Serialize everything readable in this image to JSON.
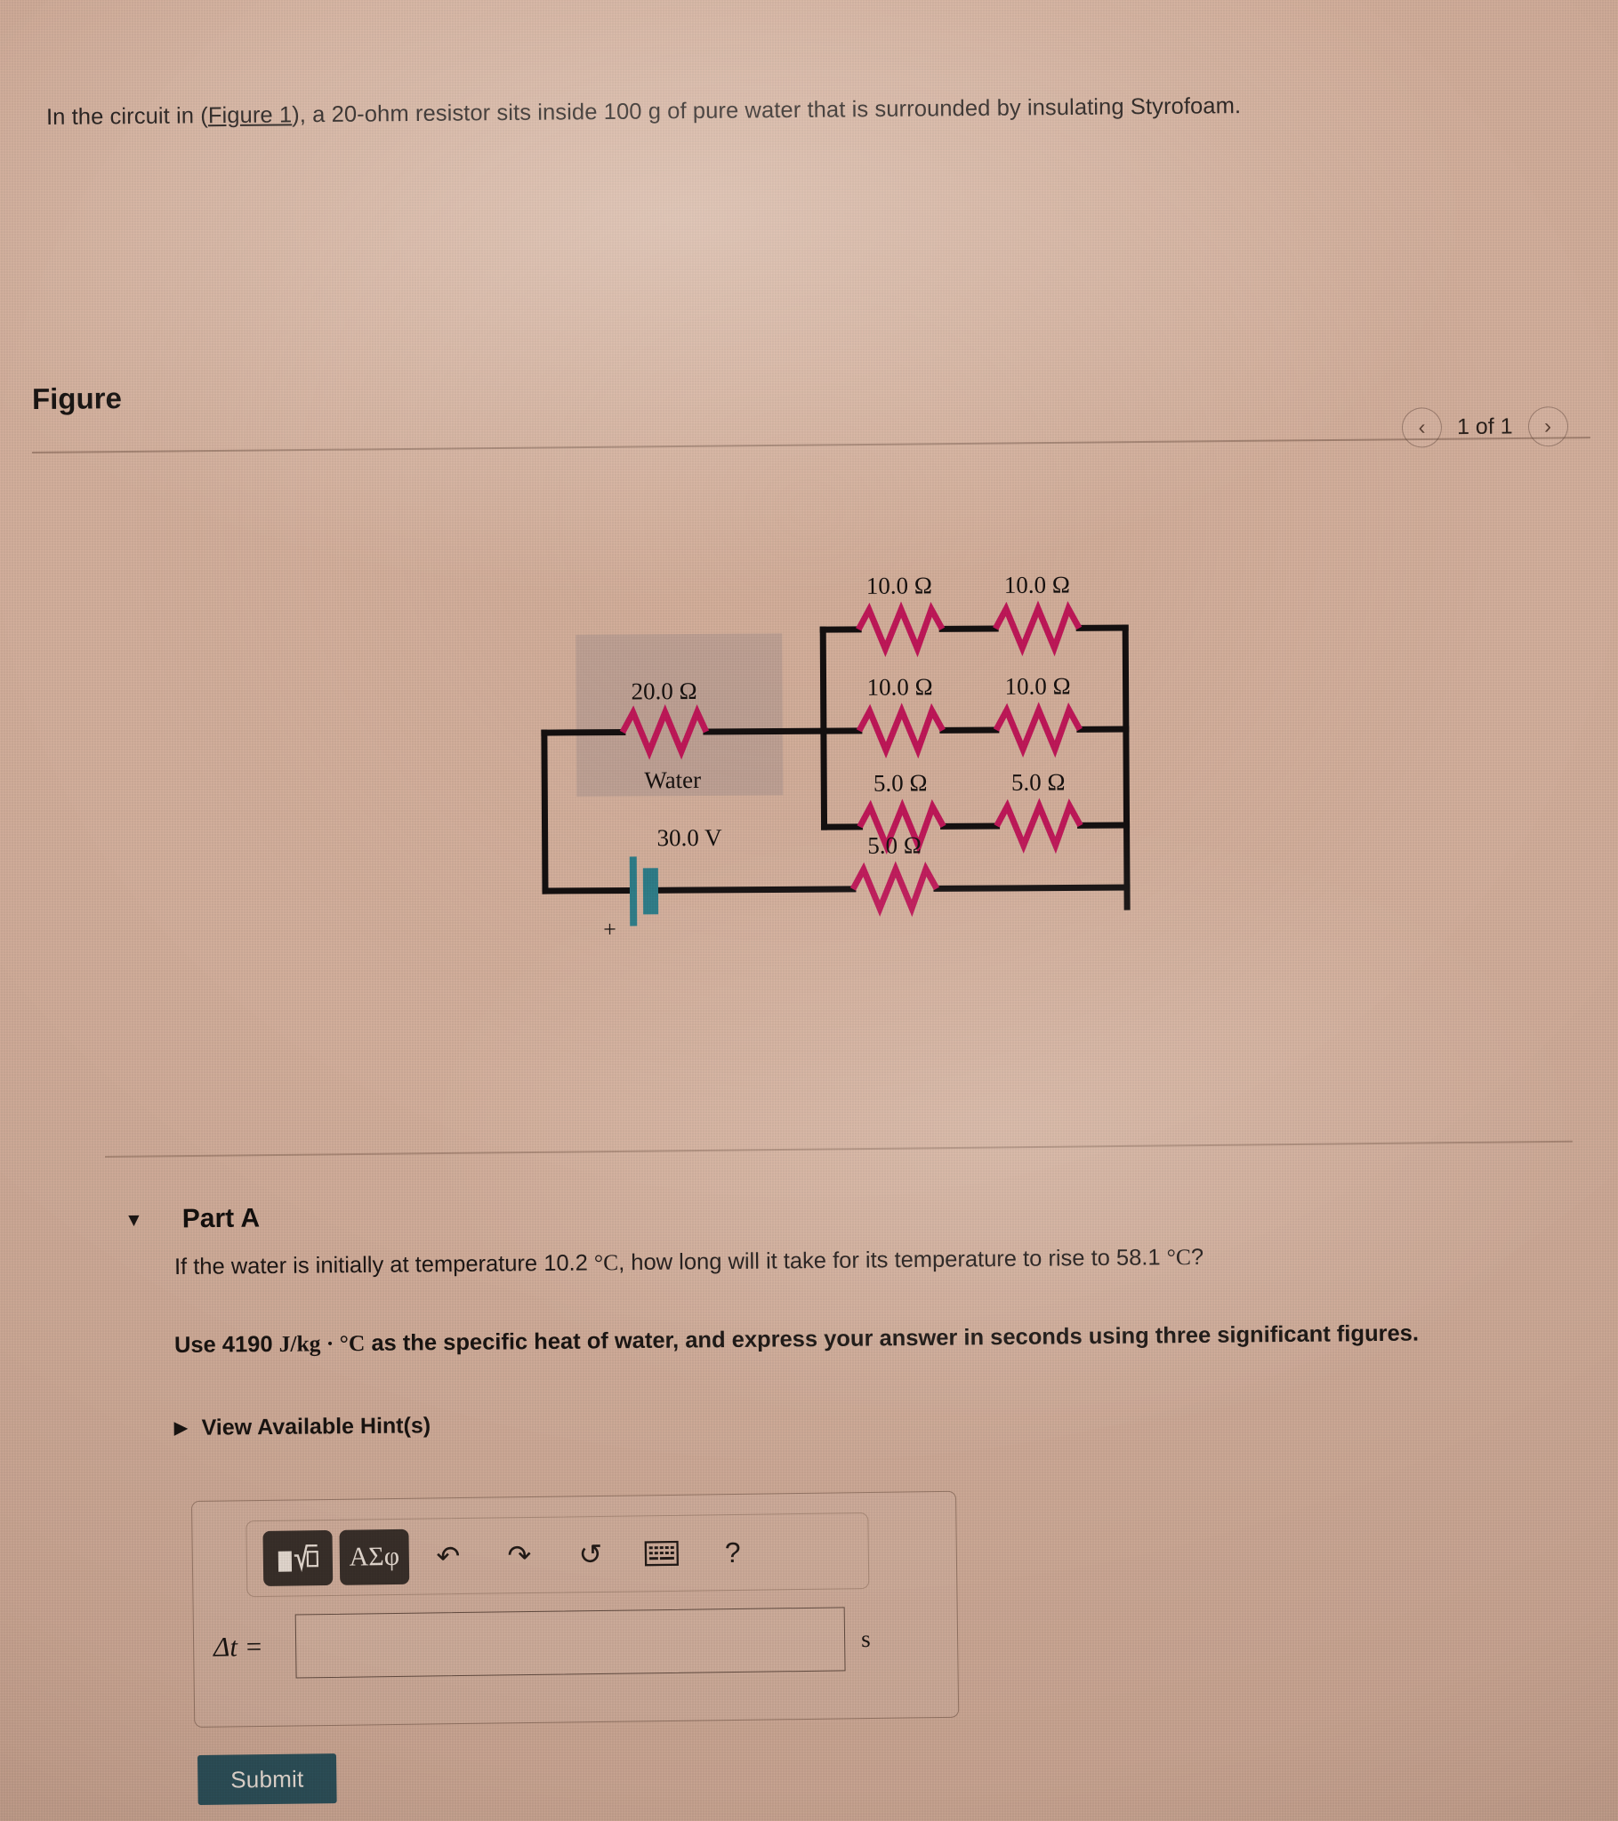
{
  "problem": {
    "text_before_link": "In the circuit in (",
    "figure_link": "Figure 1",
    "text_after_link": "), a 20-ohm resistor sits inside 100 g of pure water that is surrounded by insulating Styrofoam."
  },
  "figure": {
    "title": "Figure",
    "pager_label": "1 of 1",
    "prev_icon": "chevron-left-icon",
    "next_icon": "chevron-right-icon"
  },
  "circuit": {
    "water_label": "Water",
    "heater_resistor": "20.0 Ω",
    "battery_voltage": "30.0 V",
    "battery_polarity": "+",
    "row_top": {
      "left": "10.0 Ω",
      "right": "10.0 Ω"
    },
    "row_middle": {
      "left": "10.0 Ω",
      "right": "10.0 Ω"
    },
    "row_lower": {
      "left": "5.0 Ω",
      "right": "5.0 Ω"
    },
    "row_bottom": {
      "resistor": "5.0 Ω"
    },
    "colors": {
      "wire": "#141010",
      "resistor": "#c2185b",
      "battery": "#2e7f8c",
      "water_box": "rgba(120,120,128,0.22)"
    }
  },
  "part_a": {
    "caret": "▼",
    "label": "Part A",
    "question_p1": "If the water is initially at temperature 10.2 ",
    "question_deg1": "°C",
    "question_p2": ", how long will it take for its temperature to rise to 58.1 ",
    "question_deg2": "°C",
    "question_p3": "?",
    "instruction_p1": "Use 4190 ",
    "instruction_units": "J/kg · °C",
    "instruction_p2": " as the specific heat of water, and express your answer in seconds using three significant figures.",
    "hints_caret": "▶",
    "hints_label": "View Available Hint(s)"
  },
  "answer": {
    "toolbar": {
      "template_button": "√",
      "template_name": "math-template-button",
      "greek_button": "ΑΣφ",
      "undo_icon": "undo-arrow-icon",
      "undo_glyph": "↶",
      "redo_icon": "redo-arrow-icon",
      "redo_glyph": "↷",
      "reset_icon": "reset-circle-icon",
      "reset_glyph": "↺",
      "keyboard_icon": "keyboard-icon",
      "help_icon": "question-mark-icon",
      "help_glyph": "?"
    },
    "symbol": "Δt =",
    "value": "",
    "placeholder": "",
    "unit": "s"
  },
  "submit": {
    "label": "Submit"
  }
}
